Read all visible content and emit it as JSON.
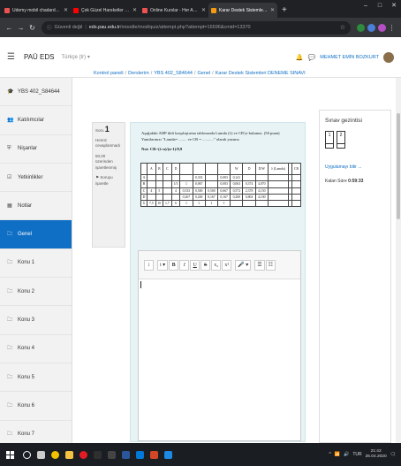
{
  "browser": {
    "tabs": [
      {
        "title": "Udemy mobil chadarda() | Udem",
        "favicon_color": "#ec5252",
        "active": false
      },
      {
        "title": "Çok Güzel Hareketler 2 | Çok Rü",
        "favicon_color": "#ff0000",
        "active": false
      },
      {
        "title": "Online Kurslar - Her Aş, Her Yer",
        "favicon_color": "#ec5252",
        "active": false
      },
      {
        "title": "Karar Destek Sistemleri DENEMI",
        "favicon_color": "#f39c12",
        "active": true
      }
    ],
    "new_tab": "+",
    "window_controls": [
      "–",
      "□",
      "✕"
    ],
    "security_label": "Güvenli değil",
    "url_host": "eds.pau.edu.tr",
    "url_path": "/moodle/mod/quiz/attempt.php?attempt=16596&cmid=13370"
  },
  "navbar": {
    "brand": "PAÜ EDS",
    "language": "Türkçe (tr) ▾",
    "user_name": "MEHMET EMİN BOZKURT"
  },
  "drawer": {
    "items": [
      {
        "label": "YBS 402_S84644",
        "icon": "graduation-cap-icon",
        "glyph": "🎓",
        "selected": false
      },
      {
        "label": "Katılımcılar",
        "icon": "users-icon",
        "glyph": "👥",
        "selected": false
      },
      {
        "label": "Nişanlar",
        "icon": "shield-icon",
        "glyph": "⛨",
        "selected": false
      },
      {
        "label": "Yetkinlikler",
        "icon": "checkbox-icon",
        "glyph": "☑",
        "selected": false
      },
      {
        "label": "Notlar",
        "icon": "table-icon",
        "glyph": "▦",
        "selected": false
      },
      {
        "label": "Genel",
        "icon": "folder-icon",
        "glyph": "🗀",
        "selected": true
      },
      {
        "label": "Konu 1",
        "icon": "folder-icon",
        "glyph": "🗀",
        "selected": false
      },
      {
        "label": "Konu 2",
        "icon": "folder-icon",
        "glyph": "🗀",
        "selected": false
      },
      {
        "label": "Konu 3",
        "icon": "folder-icon",
        "glyph": "🗀",
        "selected": false
      },
      {
        "label": "Konu 4",
        "icon": "folder-icon",
        "glyph": "🗀",
        "selected": false
      },
      {
        "label": "Konu 5",
        "icon": "folder-icon",
        "glyph": "🗀",
        "selected": false
      },
      {
        "label": "Konu 6",
        "icon": "folder-icon",
        "glyph": "🗀",
        "selected": false
      },
      {
        "label": "Konu 7",
        "icon": "folder-icon",
        "glyph": "🗀",
        "selected": false
      }
    ]
  },
  "breadcrumb": [
    "Kontrol paneli",
    "Derslerim",
    "YBS 402_S84644",
    "Genel",
    "Karar Destek Sistemleri DENEME SINAVI"
  ],
  "question_info": {
    "label": "Soru",
    "number": "1",
    "status": "Henüz cevaplanmadı",
    "max_grade": "50,00 üzerinden işaretlenmiş",
    "flag": "Soruyu işaretle"
  },
  "question": {
    "line1": "Aşağıdaki AHP ikili karşılaştırma tablosunda Lamda (λ) ve CR'yi bulunuz. (50 puan)",
    "line2": "Yanıtlarınızı \"Lamda= ........ ve CR = ...........\" olarak yazınız.",
    "line3": "Not: CR=(λ-n)/(n-1)/0,9",
    "table": {
      "header": [
        "",
        "A",
        "B",
        "C",
        "D",
        "",
        "",
        "",
        "",
        "W",
        "D",
        "D/W",
        "λ (Lamda)",
        "",
        "CR"
      ],
      "rows": [
        [
          "A",
          "",
          "",
          "",
          "",
          "",
          "0,333",
          "",
          "0,083",
          "0,141",
          "",
          "",
          "",
          "",
          ""
        ],
        [
          "B",
          "",
          "",
          "",
          "1/3",
          "1",
          "0,067",
          "",
          "0,083",
          "0,063",
          "0,374",
          "4,070",
          "",
          "",
          ""
        ],
        [
          "C",
          "4",
          "5",
          "",
          "4",
          "0,533",
          "0,500",
          "0,500",
          "0,667",
          "0,572",
          "2,378",
          "4,150",
          "",
          "",
          ""
        ],
        [
          "D",
          "",
          "",
          "",
          "",
          "0,267",
          "0,200",
          "0,167",
          "0,167",
          "0,200",
          "0,804",
          "4,100",
          "",
          "",
          ""
        ],
        [
          "Σ",
          "7,5",
          "10",
          "1,7",
          "6",
          "1",
          "1",
          "1",
          "1",
          "",
          "",
          "",
          "",
          "",
          ""
        ]
      ]
    }
  },
  "editor": {
    "toolbar": [
      "↕",
      "i ▾",
      "B",
      "I",
      "U",
      "S",
      "x₂",
      "x²",
      "🎤 ▾",
      "☰",
      "☷"
    ]
  },
  "quiz_nav": {
    "title": "Sınav gezintisi",
    "buttons": [
      "1",
      "2"
    ],
    "finish_link": "Uygulamayı bitir ...",
    "time_label": "Kalan Süre",
    "time_value": "0:59:33"
  },
  "taskbar": {
    "apps": [
      {
        "icon": "search-icon",
        "color": "#ffffff"
      },
      {
        "icon": "task-view-icon",
        "color": "#cccccc"
      },
      {
        "icon": "chrome-icon",
        "color": "#f2c200"
      },
      {
        "icon": "file-explorer-icon",
        "color": "#f5c242"
      },
      {
        "icon": "opera-icon",
        "color": "#e31b23"
      },
      {
        "icon": "media-icon",
        "color": "#2f2f2f"
      },
      {
        "icon": "terminal-icon",
        "color": "#444444"
      },
      {
        "icon": "word-icon",
        "color": "#2b579a"
      },
      {
        "icon": "store-icon",
        "color": "#0078d7"
      },
      {
        "icon": "powerpoint-icon",
        "color": "#d24726"
      },
      {
        "icon": "mail-icon",
        "color": "#1e88e5"
      }
    ],
    "language": "TUR",
    "time": "21:42",
    "date": "26.04.2020"
  }
}
